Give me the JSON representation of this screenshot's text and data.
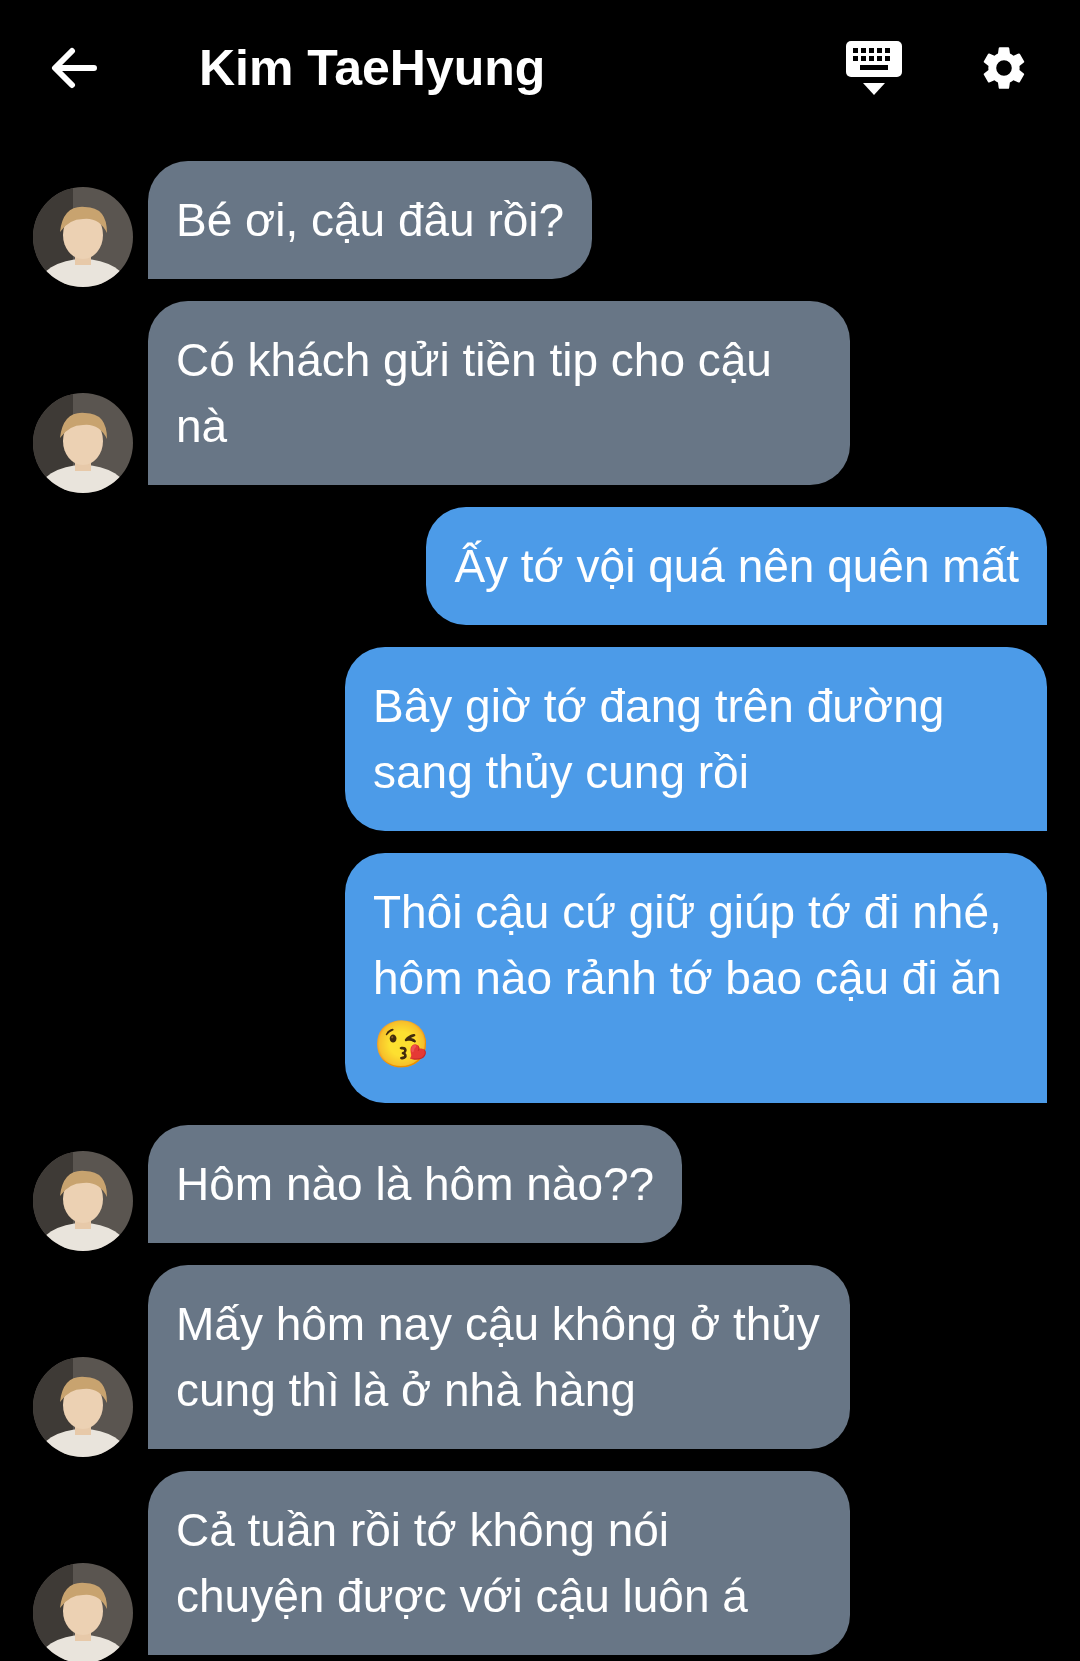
{
  "header": {
    "title": "Kim TaeHyung"
  },
  "messages": [
    {
      "kind": "received",
      "text": "Bé ơi, cậu đâu rồi?"
    },
    {
      "kind": "received",
      "text": "Có khách gửi tiền tip cho cậu nà"
    },
    {
      "kind": "sent",
      "text": "Ấy tớ vội quá nên quên mất"
    },
    {
      "kind": "sent",
      "text": "Bây giờ tớ đang trên đường sang thủy cung rồi"
    },
    {
      "kind": "sent",
      "text": "Thôi cậu cứ giữ giúp tớ đi nhé, hôm nào rảnh tớ bao cậu đi ăn 😘"
    },
    {
      "kind": "received",
      "text": "Hôm nào là hôm nào??"
    },
    {
      "kind": "received",
      "text": "Mấy hôm nay cậu không ở thủy cung thì là ở nhà hàng"
    },
    {
      "kind": "received",
      "text": "Cả tuần rồi tớ không nói chuyện được với cậu luôn á"
    }
  ]
}
